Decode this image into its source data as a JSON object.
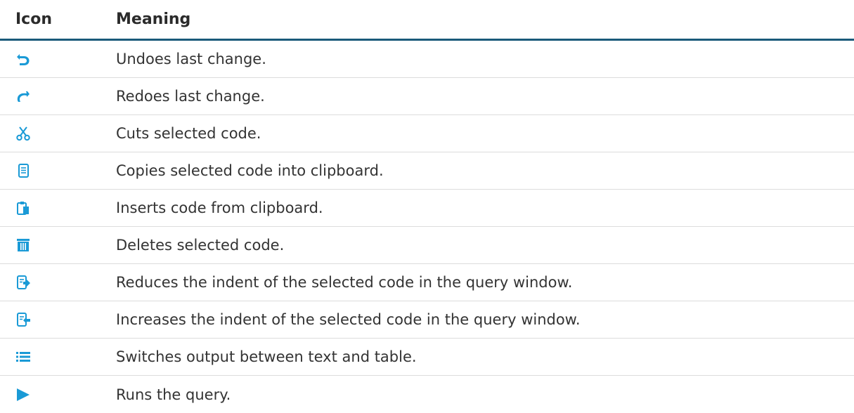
{
  "table": {
    "headers": {
      "icon": "Icon",
      "meaning": "Meaning"
    },
    "accent_color": "#1a9ad6",
    "rows": [
      {
        "icon": "undo-icon",
        "meaning": "Undoes last change."
      },
      {
        "icon": "redo-icon",
        "meaning": "Redoes last change."
      },
      {
        "icon": "cut-icon",
        "meaning": "Cuts selected code."
      },
      {
        "icon": "copy-icon",
        "meaning": "Copies selected code into clipboard."
      },
      {
        "icon": "paste-icon",
        "meaning": "Inserts code from clipboard."
      },
      {
        "icon": "delete-icon",
        "meaning": "Deletes selected code."
      },
      {
        "icon": "outdent-icon",
        "meaning": "Reduces the indent of the selected code in the query window."
      },
      {
        "icon": "indent-icon",
        "meaning": "Increases the indent of the selected code in the query window."
      },
      {
        "icon": "list-icon",
        "meaning": "Switches output between text and table."
      },
      {
        "icon": "play-icon",
        "meaning": "Runs the query."
      }
    ]
  }
}
